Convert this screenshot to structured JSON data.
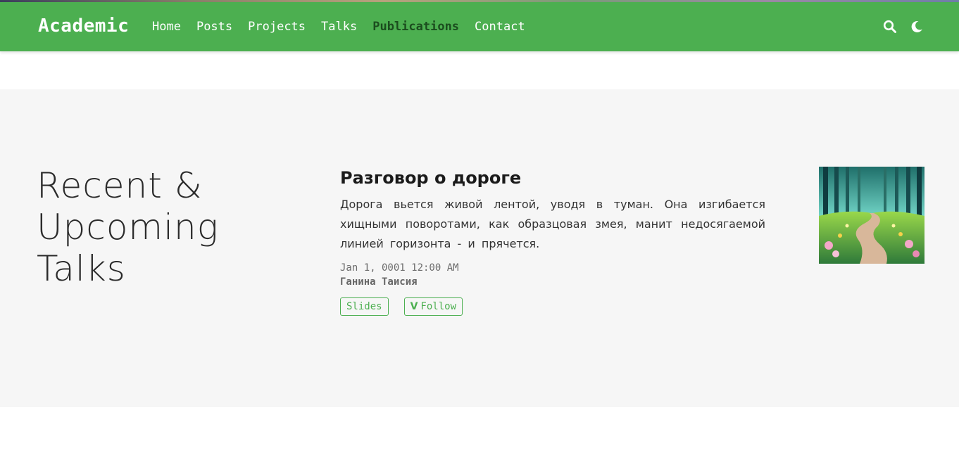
{
  "colors": {
    "brand_green": "#4caf50",
    "active_nav": "#1b4d1e",
    "section_bg": "#f6f6f6"
  },
  "navbar": {
    "brand": "Academic",
    "items": [
      {
        "label": "Home",
        "active": false
      },
      {
        "label": "Posts",
        "active": false
      },
      {
        "label": "Projects",
        "active": false
      },
      {
        "label": "Talks",
        "active": false
      },
      {
        "label": "Publications",
        "active": true
      },
      {
        "label": "Contact",
        "active": false
      }
    ],
    "icons": [
      "search-icon",
      "moon-icon"
    ]
  },
  "section": {
    "title_lines": [
      "Recent &",
      "Upcoming",
      "Talks"
    ]
  },
  "talk": {
    "title": "Разговор о дороге",
    "summary": "Дорога вьется живой лентой, уводя в туман. Она изгибается хищными поворотами, как образцовая змея, манит недосягаемой линией горизонта - и прячется.",
    "date": "Jan 1, 0001 12:00 AM",
    "author": "Ганина Таисия",
    "buttons": {
      "slides": "Slides",
      "follow_icon": "V",
      "follow": "Follow"
    },
    "thumbnail_icon": "forest-path-image"
  }
}
